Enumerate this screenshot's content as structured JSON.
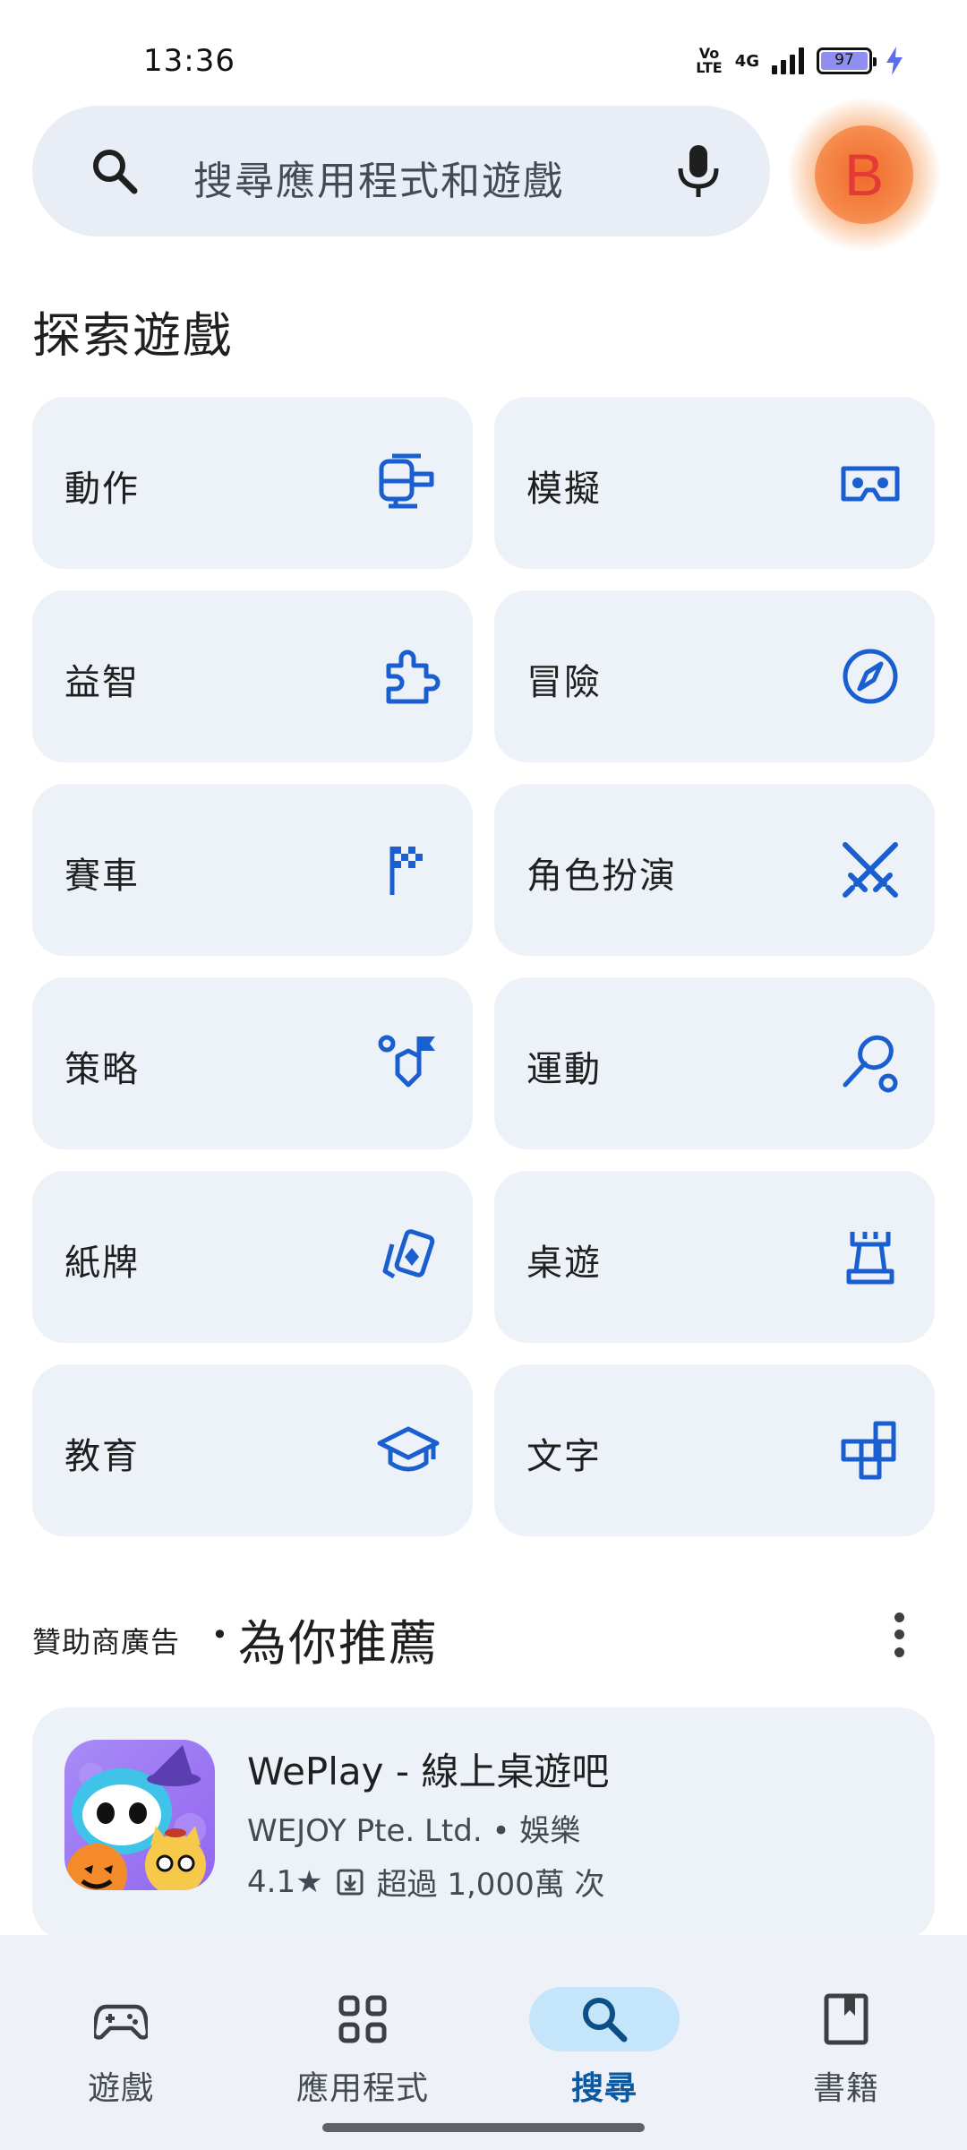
{
  "status_bar": {
    "time": "13:36",
    "volte": "Vo LTE",
    "network": "4G",
    "battery": "97"
  },
  "search": {
    "placeholder": "搜尋應用程式和遊戲",
    "avatar_letter": "B"
  },
  "explore": {
    "title": "探索遊戲",
    "categories": [
      {
        "label": "動作",
        "icon": "helicopter-icon"
      },
      {
        "label": "模擬",
        "icon": "vr-headset-icon"
      },
      {
        "label": "益智",
        "icon": "puzzle-icon"
      },
      {
        "label": "冒險",
        "icon": "compass-icon"
      },
      {
        "label": "賽車",
        "icon": "checkered-flag-icon"
      },
      {
        "label": "角色扮演",
        "icon": "crossed-swords-icon"
      },
      {
        "label": "策略",
        "icon": "strategy-icon"
      },
      {
        "label": "運動",
        "icon": "tennis-racket-icon"
      },
      {
        "label": "紙牌",
        "icon": "cards-icon"
      },
      {
        "label": "桌遊",
        "icon": "chess-rook-icon"
      },
      {
        "label": "教育",
        "icon": "graduation-cap-icon"
      },
      {
        "label": "文字",
        "icon": "word-tiles-icon"
      }
    ]
  },
  "sponsored": {
    "label": "贊助商廣告",
    "dot": "•",
    "title": "為你推薦"
  },
  "app": {
    "name": "WePlay - 線上桌遊吧",
    "developer": "WEJOY Pte. Ltd. • 娛樂",
    "rating": "4.1★",
    "downloads": "超過 1,000萬 次"
  },
  "bottom_nav": {
    "items": [
      {
        "label": "遊戲",
        "icon": "gamepad-icon",
        "active": false
      },
      {
        "label": "應用程式",
        "icon": "apps-grid-icon",
        "active": false
      },
      {
        "label": "搜尋",
        "icon": "search-icon",
        "active": true
      },
      {
        "label": "書籍",
        "icon": "book-icon",
        "active": false
      }
    ]
  },
  "colors": {
    "accent_icon": "#1a5fd0",
    "active_nav": "#0b57a0",
    "active_pill": "#c5e5fb",
    "card_bg": "#edf1f8"
  }
}
